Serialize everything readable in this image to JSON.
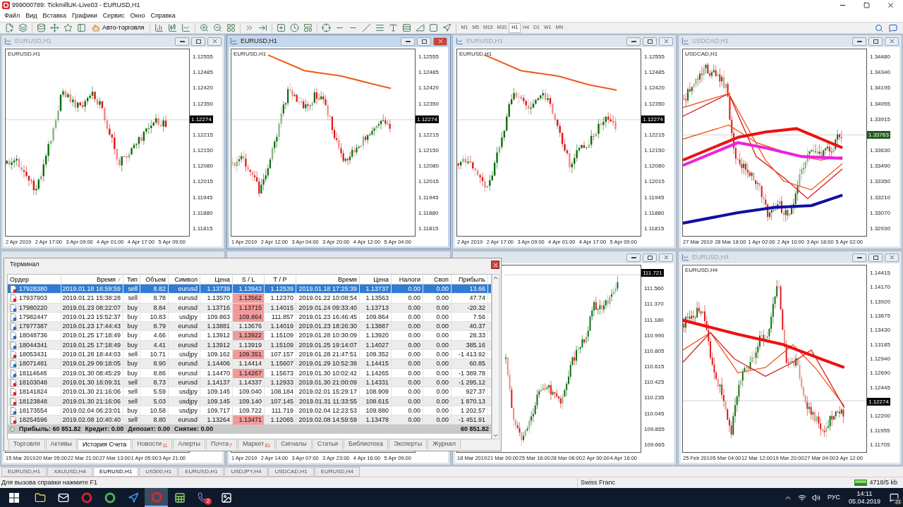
{
  "window": {
    "title": "999000789: TickmillUK-Live03 - EURUSD,H1"
  },
  "menu": [
    "Файл",
    "Вид",
    "Вставка",
    "Графики",
    "Сервис",
    "Окно",
    "Справка"
  ],
  "toolbar": {
    "autotrading": "Авто-торговля",
    "timeframes": [
      {
        "label": "M1",
        "selected": false
      },
      {
        "label": "M5",
        "selected": false
      },
      {
        "label": "M15",
        "selected": false
      },
      {
        "label": "M30",
        "selected": false
      },
      {
        "label": "H1",
        "selected": true
      },
      {
        "label": "H4",
        "selected": false
      },
      {
        "label": "D1",
        "selected": false
      },
      {
        "label": "W1",
        "selected": false
      },
      {
        "label": "MN",
        "selected": false
      }
    ]
  },
  "charts": [
    {
      "title": "EURUSD,H1",
      "active": false,
      "symbol_label": "EURUSD,H1",
      "plot": {
        "kind": "picture"
      },
      "price_labels": [
        {
          "text": "1.12555"
        },
        {
          "text": "1.12485"
        },
        {
          "text": "1.12420"
        },
        {
          "text": "1.12350"
        },
        {
          "text": "1.12274",
          "kind": "current",
          "color": "#000000"
        },
        {
          "text": "1.12215"
        },
        {
          "text": "1.12150"
        },
        {
          "text": "1.12080"
        },
        {
          "text": "1.12015"
        },
        {
          "text": "1.11945"
        },
        {
          "text": "1.11880"
        },
        {
          "text": "1.11815"
        }
      ],
      "time_labels": [
        "2 Apr 2019",
        "2 Apr 17:00",
        "3 Apr 09:00",
        "4 Apr 01:00",
        "4 Apr 17:00",
        "5 Apr 09:00"
      ]
    },
    {
      "title": "EURUSD,H1",
      "active": true,
      "symbol_label": "EURUSD,H1",
      "plot": {
        "kind": "picture"
      },
      "price_labels": [
        {
          "text": "1.12555"
        },
        {
          "text": "1.12485"
        },
        {
          "text": "1.12420"
        },
        {
          "text": "1.12350"
        },
        {
          "text": "1.12274",
          "kind": "current",
          "color": "#000000"
        },
        {
          "text": "1.12215"
        },
        {
          "text": "1.12150"
        },
        {
          "text": "1.12080"
        },
        {
          "text": "1.12015"
        },
        {
          "text": "1.11945"
        },
        {
          "text": "1.11880"
        },
        {
          "text": "1.11815"
        }
      ],
      "time_labels": [
        "1 Apr 2019",
        "2 Apr 12:00",
        "3 Apr 04:00",
        "3 Apr 20:00",
        "4 Apr 12:00",
        "5 Apr 04:00"
      ]
    },
    {
      "title": "EURUSD,H1",
      "active": false,
      "symbol_label": "EURUSD,H1",
      "plot": {
        "kind": "picture"
      },
      "price_labels": [
        {
          "text": "1.12555"
        },
        {
          "text": "1.12485"
        },
        {
          "text": "1.12420"
        },
        {
          "text": "1.12350"
        },
        {
          "text": "1.12274",
          "kind": "current",
          "color": "#000000"
        },
        {
          "text": "1.12215"
        },
        {
          "text": "1.12150"
        },
        {
          "text": "1.12080"
        },
        {
          "text": "1.12015"
        },
        {
          "text": "1.11945"
        },
        {
          "text": "1.11880"
        },
        {
          "text": "1.11815"
        }
      ],
      "time_labels": [
        "2 Apr 2019",
        "2 Apr 17:00",
        "3 Apr 09:00",
        "4 Apr 01:00",
        "4 Apr 17:00",
        "5 Apr 09:00"
      ]
    },
    {
      "title": "USDCAD,H1",
      "active": false,
      "symbol_label": "USDCAD,H1",
      "plot": {
        "kind": "picture"
      },
      "price_labels": [
        {
          "text": "1.34480"
        },
        {
          "text": "1.34340"
        },
        {
          "text": "1.34195"
        },
        {
          "text": "1.34055"
        },
        {
          "text": "1.33915"
        },
        {
          "text": "1.33763",
          "kind": "current",
          "color": "#1f5a1f"
        },
        {
          "text": "1.33630"
        },
        {
          "text": "1.33490"
        },
        {
          "text": "1.33350"
        },
        {
          "text": "1.33210"
        },
        {
          "text": "1.33070"
        },
        {
          "text": "1.32930"
        }
      ],
      "time_labels": [
        "27 Mar 2019",
        "28 Mar 18:00",
        "1 Apr 02:00",
        "2 Apr 10:00",
        "3 Apr 18:00",
        "5 Apr 02:00"
      ]
    },
    {
      "active": false,
      "time_labels": [
        "15 Mar 2019",
        "20 Mar 05:00",
        "22 Mar 21:00",
        "27 Mar 13:00",
        "1 Apr 05:00",
        "3 Apr 21:00"
      ]
    },
    {
      "active": false,
      "time_labels": [
        "1 Apr 2019",
        "2 Apr 14:00",
        "3 Apr 07:00",
        "3 Apr 23:00",
        "4 Apr 16:00",
        "5 Apr 09:00"
      ]
    },
    {
      "active": false,
      "plot": {
        "kind": "picture"
      },
      "price_labels": [
        {
          "text": "111.721",
          "kind": "current",
          "color": "#000000"
        },
        {
          "text": "111.560"
        },
        {
          "text": "111.370"
        },
        {
          "text": "111.180"
        },
        {
          "text": "110.990"
        },
        {
          "text": "110.805"
        },
        {
          "text": "110.615"
        },
        {
          "text": "110.425"
        },
        {
          "text": "110.235"
        },
        {
          "text": "110.045"
        },
        {
          "text": "109.855"
        },
        {
          "text": "109.665"
        }
      ],
      "time_labels": [
        "18 Mar 2019",
        "21 Mar 00:00",
        "25 Mar 16:00",
        "28 Mar 08:00",
        "2 Apr 00:00",
        "4 Apr 16:00"
      ]
    },
    {
      "title": "EURUSD,H4",
      "active": false,
      "symbol_label": "EURUSD,H4",
      "plot": {
        "kind": "picture"
      },
      "price_labels": [
        {
          "text": "1.14415"
        },
        {
          "text": "1.14170"
        },
        {
          "text": "1.13920"
        },
        {
          "text": "1.13675"
        },
        {
          "text": "1.13430"
        },
        {
          "text": "1.13185"
        },
        {
          "text": "1.12940"
        },
        {
          "text": "1.12690"
        },
        {
          "text": "1.12445"
        },
        {
          "text": "1.12274",
          "kind": "current",
          "color": "#000000"
        },
        {
          "text": "1.12200"
        },
        {
          "text": "1.11955"
        },
        {
          "text": "1.11705"
        }
      ],
      "time_labels": [
        "25 Feb 2019",
        "5 Mar 04:00",
        "12 Mar 12:00",
        "19 Mar 20:00",
        "27 Mar 04:00",
        "3 Apr 12:00"
      ]
    }
  ],
  "terminal": {
    "title": "Терминал",
    "columns": [
      "Ордер",
      "Время",
      "Тип",
      "Объем",
      "Символ",
      "Цена",
      "S / L",
      "T / P",
      "Время",
      "Цена",
      "Налоги",
      "Своп",
      "Прибыль"
    ],
    "rows": [
      {
        "order": "17928380",
        "open_time": "2019.01.18 16:59:59",
        "type": "sell",
        "kind": "sell",
        "volume": "8.82",
        "symbol": "eurusd",
        "price": "1.13739",
        "sl": "1.13943",
        "sl_hit": false,
        "tp": "1.12539",
        "close_time": "2019.01.18 17:25:39",
        "close_price": "1.13737",
        "taxes": "0.00",
        "swap": "0.00",
        "profit": "13.66",
        "selected": true
      },
      {
        "order": "17937903",
        "open_time": "2019.01.21 15:38:28",
        "type": "sell",
        "kind": "sell",
        "volume": "8.78",
        "symbol": "eurusd",
        "price": "1.13570",
        "sl": "1.13562",
        "sl_hit": true,
        "tp": "1.12370",
        "close_time": "2019.01.22 10:08:54",
        "close_price": "1.13563",
        "taxes": "0.00",
        "swap": "0.00",
        "profit": "47.74",
        "selected": false
      },
      {
        "order": "17980220",
        "open_time": "2019.01.23 08:22:07",
        "type": "buy",
        "kind": "buy",
        "volume": "8.84",
        "symbol": "eurusd",
        "price": "1.13716",
        "sl": "1.13715",
        "sl_hit": true,
        "tp": "1.14015",
        "close_time": "2019.01.24 09:33:40",
        "close_price": "1.13713",
        "taxes": "0.00",
        "swap": "0.00",
        "profit": "-20.32",
        "selected": false
      },
      {
        "order": "17982447",
        "open_time": "2019.01.23 15:52:37",
        "type": "buy",
        "kind": "buy",
        "volume": "10.83",
        "symbol": "usdjpy",
        "price": "109.863",
        "sl": "109.864",
        "sl_hit": true,
        "tp": "111.857",
        "close_time": "2019.01.23 16:46:45",
        "close_price": "109.864",
        "taxes": "0.00",
        "swap": "0.00",
        "profit": "7.56",
        "selected": false
      },
      {
        "order": "17977387",
        "open_time": "2019.01.23 17:44:43",
        "type": "buy",
        "kind": "buy",
        "volume": "8.79",
        "symbol": "eurusd",
        "price": "1.13881",
        "sl": "1.13676",
        "sl_hit": false,
        "tp": "1.14019",
        "close_time": "2019.01.23 18:26:30",
        "close_price": "1.13887",
        "taxes": "0.00",
        "swap": "0.00",
        "profit": "40.37",
        "selected": false
      },
      {
        "order": "18048736",
        "open_time": "2019.01.25 17:18:49",
        "type": "buy",
        "kind": "buy",
        "volume": "4.66",
        "symbol": "eurusd",
        "price": "1.13912",
        "sl": "1.13922",
        "sl_hit": true,
        "tp": "1.15109",
        "close_time": "2019.01.28 10:30:09",
        "close_price": "1.13920",
        "taxes": "0.00",
        "swap": "0.00",
        "profit": "28.33",
        "selected": false
      },
      {
        "order": "18044341",
        "open_time": "2019.01.25 17:18:49",
        "type": "buy",
        "kind": "buy",
        "volume": "4.41",
        "symbol": "eurusd",
        "price": "1.13912",
        "sl": "1.13919",
        "sl_hit": false,
        "tp": "1.15109",
        "close_time": "2019.01.25 19:14:07",
        "close_price": "1.14027",
        "taxes": "0.00",
        "swap": "0.00",
        "profit": "385.16",
        "selected": false
      },
      {
        "order": "18053431",
        "open_time": "2019.01.28 18:44:03",
        "type": "sell",
        "kind": "sell",
        "volume": "10.71",
        "symbol": "usdjpy",
        "price": "109.162",
        "sl": "109.351",
        "sl_hit": true,
        "tp": "107.157",
        "close_time": "2019.01.28 21:47:51",
        "close_price": "109.352",
        "taxes": "0.00",
        "swap": "0.00",
        "profit": "-1 413.92",
        "selected": false
      },
      {
        "order": "18071481",
        "open_time": "2019.01.29 09:18:05",
        "type": "buy",
        "kind": "buy",
        "volume": "8.90",
        "symbol": "eurusd",
        "price": "1.14406",
        "sl": "1.14414",
        "sl_hit": false,
        "tp": "1.15607",
        "close_time": "2019.01.29 10:52:38",
        "close_price": "1.14415",
        "taxes": "0.00",
        "swap": "0.00",
        "profit": "60.85",
        "selected": false
      },
      {
        "order": "18114648",
        "open_time": "2019.01.30 08:45:29",
        "type": "buy",
        "kind": "buy",
        "volume": "8.86",
        "symbol": "eurusd",
        "price": "1.14470",
        "sl": "1.14267",
        "sl_hit": true,
        "tp": "1.15673",
        "close_time": "2019.01.30 10:02:42",
        "close_price": "1.14265",
        "taxes": "0.00",
        "swap": "0.00",
        "profit": "-1 389.78",
        "selected": false
      },
      {
        "order": "18103048",
        "open_time": "2019.01.30 16:09:31",
        "type": "sell",
        "kind": "sell",
        "volume": "8.73",
        "symbol": "eurusd",
        "price": "1.14137",
        "sl": "1.14337",
        "sl_hit": false,
        "tp": "1.12933",
        "close_time": "2019.01.30 21:00:09",
        "close_price": "1.14331",
        "taxes": "0.00",
        "swap": "0.00",
        "profit": "-1 295.12",
        "selected": false
      },
      {
        "order": "18141824",
        "open_time": "2019.01.30 21:16:06",
        "type": "sell",
        "kind": "sell",
        "volume": "5.59",
        "symbol": "usdjpy",
        "price": "109.145",
        "sl": "109.040",
        "sl_hit": false,
        "tp": "108.184",
        "close_time": "2019.02.01 15:29:17",
        "close_price": "108.909",
        "taxes": "0.00",
        "swap": "0.00",
        "profit": "927.37",
        "selected": false
      },
      {
        "order": "18123848",
        "open_time": "2019.01.30 21:16:06",
        "type": "sell",
        "kind": "sell",
        "volume": "5.03",
        "symbol": "usdjpy",
        "price": "109.145",
        "sl": "109.140",
        "sl_hit": false,
        "tp": "107.145",
        "close_time": "2019.01.31 11:33:55",
        "close_price": "108.615",
        "taxes": "0.00",
        "swap": "0.00",
        "profit": "1 870.13",
        "selected": false
      },
      {
        "order": "18173554",
        "open_time": "2019.02.04 06:23:01",
        "type": "buy",
        "kind": "buy",
        "volume": "10.58",
        "symbol": "usdjpy",
        "price": "109.717",
        "sl": "109.722",
        "sl_hit": false,
        "tp": "111.719",
        "close_time": "2019.02.04 12:23:53",
        "close_price": "109.880",
        "taxes": "0.00",
        "swap": "0.00",
        "profit": "1 202.57",
        "selected": false
      },
      {
        "order": "18254596",
        "open_time": "2019.02.08 10:40:40",
        "type": "sell",
        "kind": "sell",
        "volume": "8.80",
        "symbol": "eurusd",
        "price": "1.13264",
        "sl": "1.13471",
        "sl_hit": true,
        "tp": "1.12065",
        "close_time": "2019.02.08 14:59:59",
        "close_price": "1.13478",
        "taxes": "0.00",
        "swap": "0.00",
        "profit": "-1 451.91",
        "selected": false
      }
    ],
    "summary": {
      "items": [
        "Прибыль: 60 851.82",
        "Кредит: 0.00",
        "Депозит: 0.00",
        "Снятие: 0.00"
      ],
      "total": "60 851.82"
    },
    "tabs": [
      {
        "label": "Торговля",
        "selected": false
      },
      {
        "label": "Активы",
        "selected": false
      },
      {
        "label": "История Счета",
        "selected": true
      },
      {
        "label": "Новости",
        "badge": "11",
        "selected": false
      },
      {
        "label": "Алерты",
        "selected": false
      },
      {
        "label": "Почта",
        "badge": "7",
        "selected": false
      },
      {
        "label": "Маркет",
        "badge": "81",
        "selected": false
      },
      {
        "label": "Сигналы",
        "selected": false
      },
      {
        "label": "Статьи",
        "selected": false
      },
      {
        "label": "Библиотека",
        "selected": false
      },
      {
        "label": "Эксперты",
        "selected": false
      },
      {
        "label": "Журнал",
        "selected": false
      }
    ]
  },
  "chart_tabs": [
    {
      "label": "EURUSD,H1",
      "selected": false
    },
    {
      "label": "XAUUSD,H4",
      "selected": false
    },
    {
      "label": "EURUSD,H1",
      "selected": true
    },
    {
      "label": "US500,H1",
      "selected": false
    },
    {
      "label": "EURUSD,H1",
      "selected": false
    },
    {
      "label": "USDJPY,H4",
      "selected": false
    },
    {
      "label": "USDCAD,H1",
      "selected": false
    },
    {
      "label": "EURUSD,H4",
      "selected": false
    }
  ],
  "status_bar": {
    "help": "Для вызова справки нажмите F1",
    "profile": "Swiss Franc",
    "traffic": "4718/5 kb"
  },
  "taskbar": {
    "apps": [
      {
        "selected": false
      },
      {
        "selected": false
      },
      {
        "selected": false
      },
      {
        "selected": false
      },
      {
        "selected": false
      },
      {
        "selected": true
      },
      {
        "selected": false
      },
      {
        "selected": false,
        "badge": "2"
      },
      {
        "selected": false
      }
    ],
    "language": "РУС",
    "time": "14:11",
    "date": "05.04.2019",
    "notifications": "21"
  }
}
